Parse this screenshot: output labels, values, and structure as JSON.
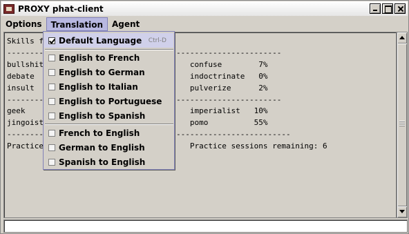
{
  "window": {
    "title": "PROXY phat-client"
  },
  "menubar": {
    "options": "Options",
    "translation": "Translation",
    "agent": "Agent"
  },
  "output": {
    "lines": [
      "Skills f",
      "--------                    cs------------------------------",
      "bullshit                    0%          confuse        7%",
      "debate                      0%          indoctrinate   0%",
      "insult                      5%          pulverize      2%",
      "--------                    es------------------------------",
      "geek                        8%          imperialist   10%",
      "jingoist                    0%          pomo          55%",
      "--------------------------------------------------------------",
      "Practice                                Practice sessions remaining: 6"
    ]
  },
  "translation_menu": {
    "items": [
      {
        "label": "Default Language",
        "accel": "Ctrl-D",
        "checked": true
      },
      {
        "label": "English to French",
        "checked": false
      },
      {
        "label": "English to German",
        "checked": false
      },
      {
        "label": "English to Italian",
        "checked": false
      },
      {
        "label": "English to Portuguese",
        "checked": false
      },
      {
        "label": "English to Spanish",
        "checked": false
      },
      {
        "label": "French to English",
        "checked": false
      },
      {
        "label": "German to English",
        "checked": false
      },
      {
        "label": "Spanish to English",
        "checked": false
      }
    ]
  },
  "command_input": {
    "value": ""
  }
}
